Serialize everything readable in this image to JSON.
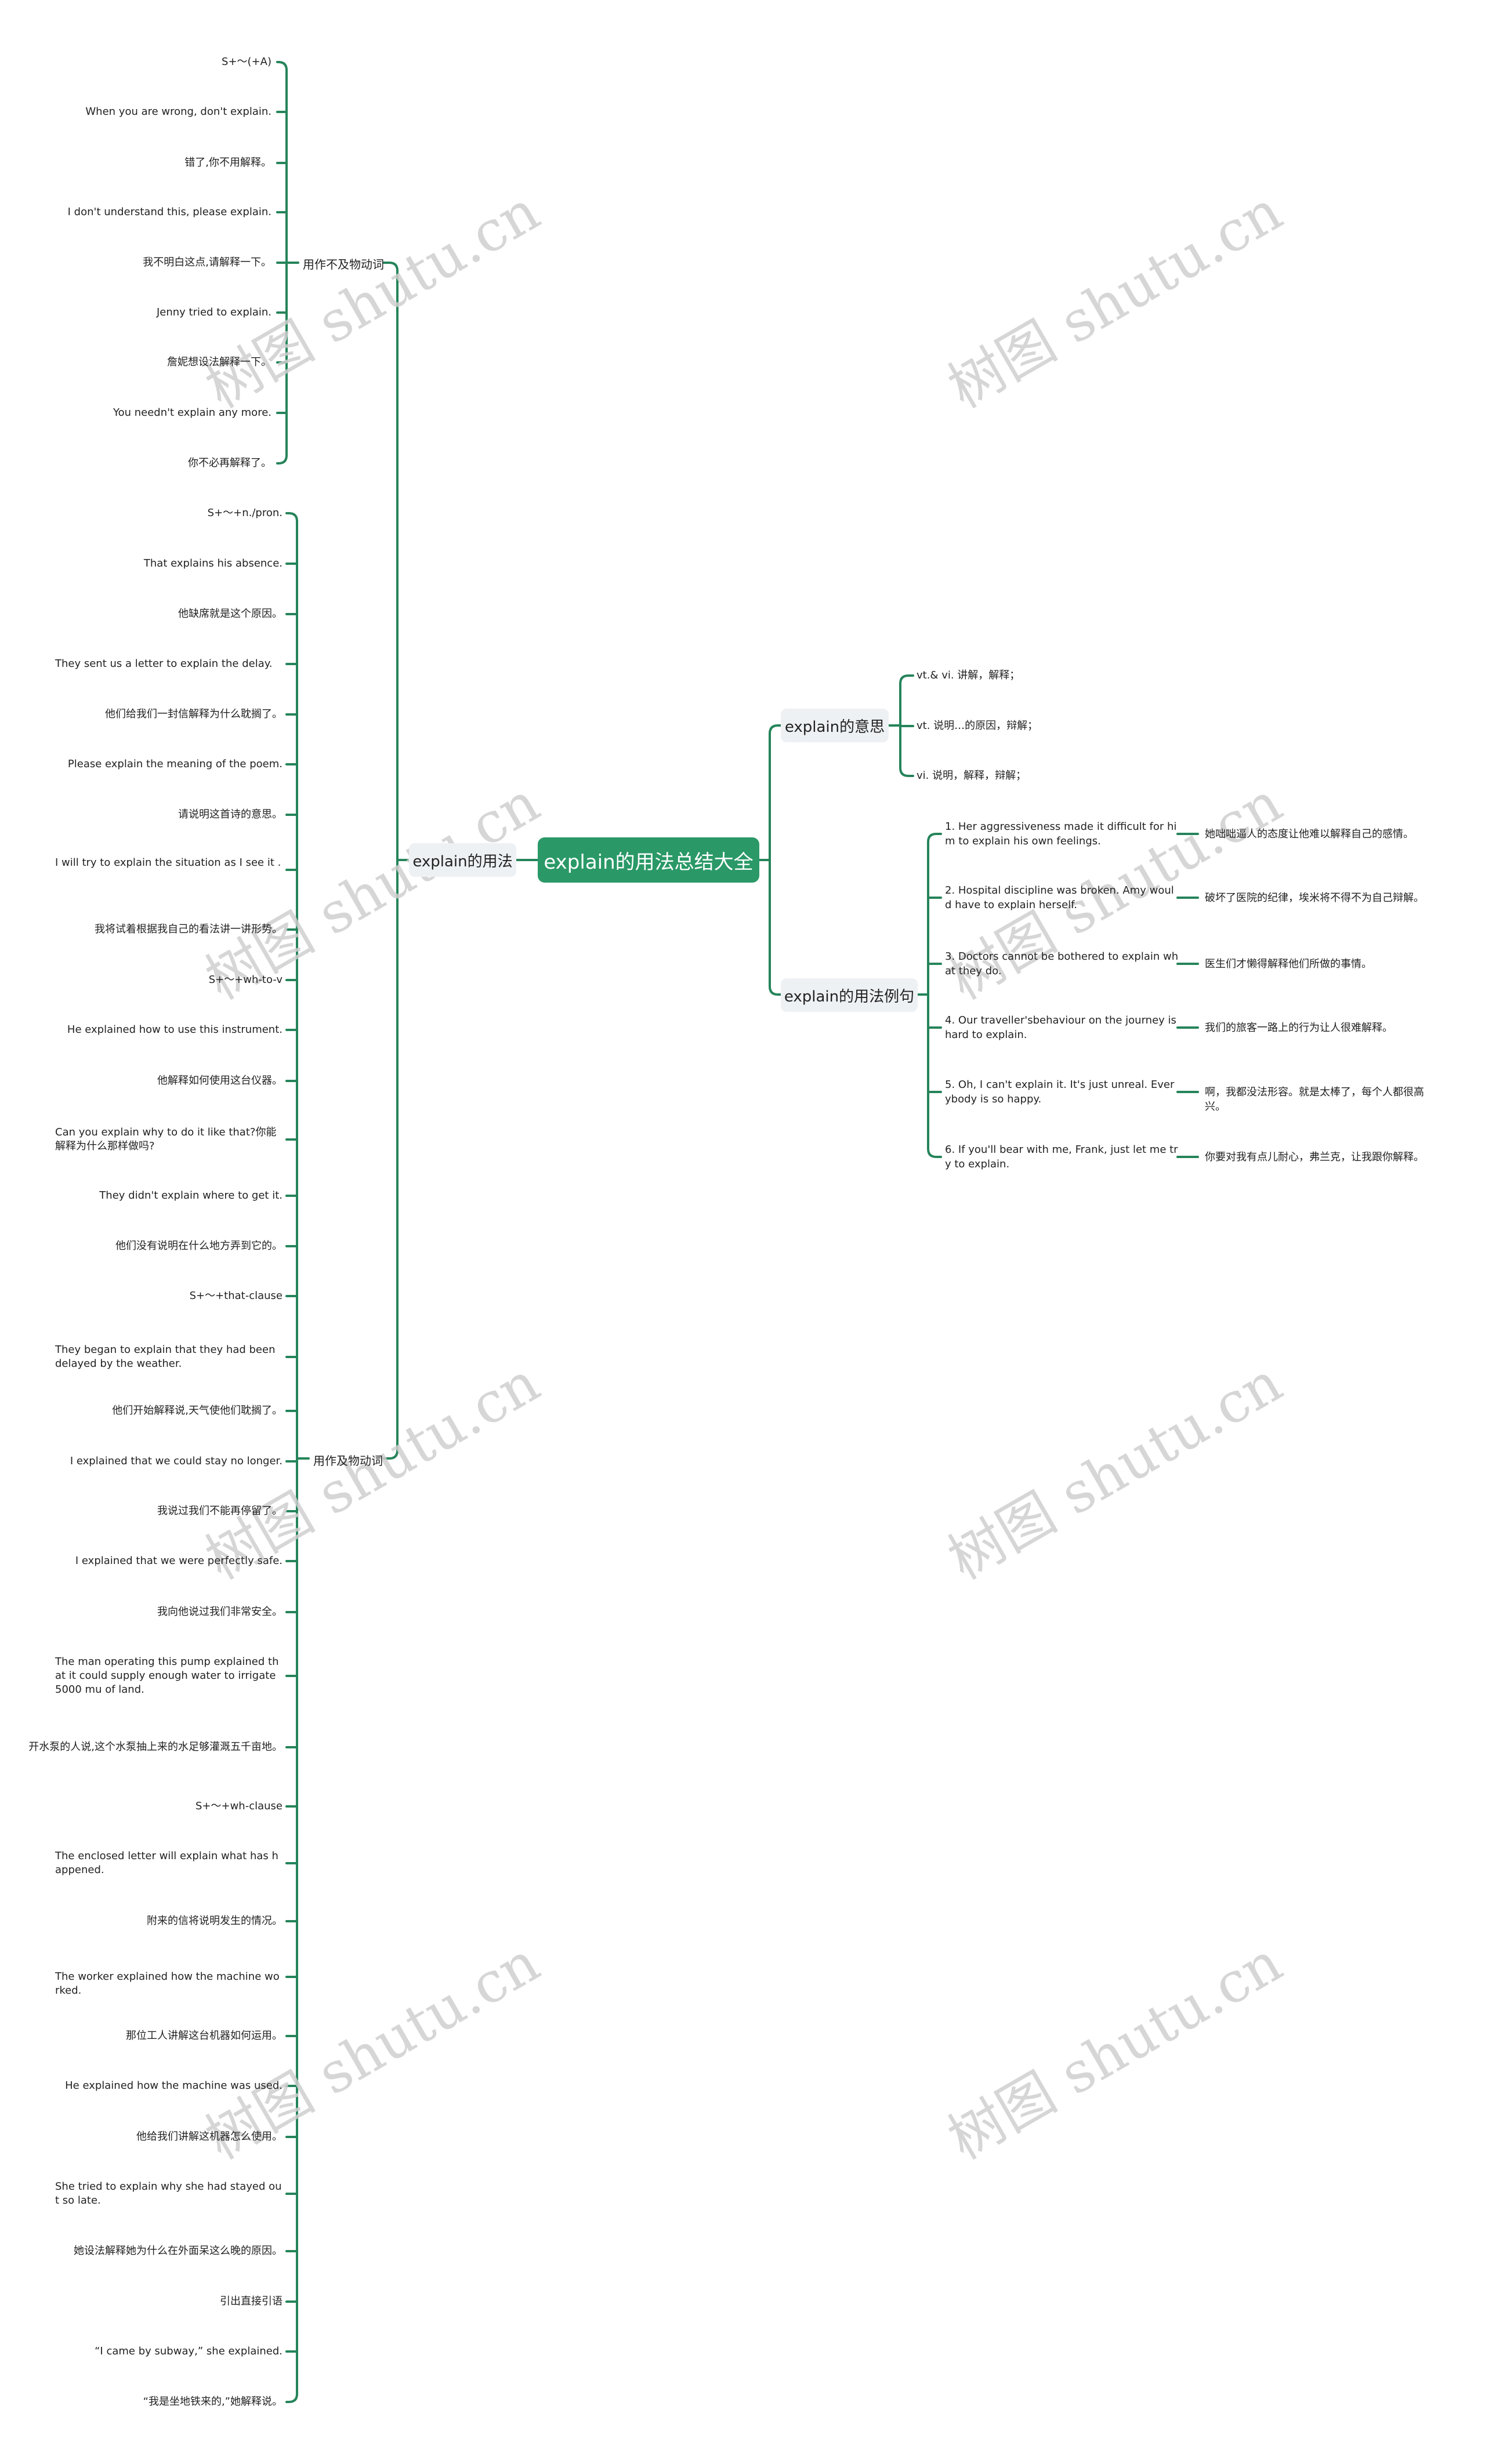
{
  "title": "explain的用法总结大全",
  "colors": {
    "line": "#25845a",
    "root_bg": "#2a9967",
    "sub_bg": "#eef1f4",
    "watermark": "#cfcfcf"
  },
  "watermark": "树图 shutu.cn",
  "left": {
    "label": "explain的用法",
    "intransitive": {
      "label": "用作不及物动词",
      "items": [
        "S+～(+A)",
        "When you are wrong, don't explain.",
        "错了,你不用解释。",
        "I don't understand this, please explain.",
        "我不明白这点,请解释一下。",
        "Jenny tried to explain.",
        "詹妮想设法解释一下。",
        "You needn't explain any more.",
        "你不必再解释了。"
      ]
    },
    "transitive": {
      "label": "用作及物动词",
      "items": [
        "S+～+n./pron.",
        "That explains his absence.",
        "他缺席就是这个原因。",
        "They sent us a letter to explain the delay.",
        "他们给我们一封信解释为什么耽搁了。",
        "Please explain the meaning of the poem.",
        "请说明这首诗的意思。",
        "I will try to explain the situation as I see it .",
        "我将试着根据我自己的看法讲一讲形势。",
        "S+～+wh-to-v",
        "He explained how to use this instrument.",
        "他解释如何使用这台仪器。",
        "Can you explain why to do it like that?你能解释为什么那样做吗?",
        "They didn't explain where to get it.",
        "他们没有说明在什么地方弄到它的。",
        "S+～+that-clause",
        "They began to explain that they had been delayed by the weather.",
        "他们开始解释说,天气使他们耽搁了。",
        "I explained that we could stay no longer.",
        "我说过我们不能再停留了。",
        "I explained that we were perfectly safe.",
        "我向他说过我们非常安全。",
        "The man operating this pump explained that it could supply enough water to irrigate 5000 mu of land.",
        "开水泵的人说,这个水泵抽上来的水足够灌溉五千亩地。",
        "S+～+wh-clause",
        "The enclosed letter will explain what has happened.",
        "附来的信将说明发生的情况。",
        "The worker explained how the machine worked.",
        "那位工人讲解这台机器如何运用。",
        "He explained how the machine was used.",
        "他给我们讲解这机器怎么使用。",
        "She tried to explain why she had stayed out so late.",
        "她设法解释她为什么在外面呆这么晚的原因。",
        "引出直接引语",
        "“I came by subway,”  she explained.",
        "“我是坐地铁来的,”她解释说。"
      ]
    }
  },
  "right": {
    "meaning": {
      "label": "explain的意思",
      "items": [
        "vt.& vi. 讲解，解释；",
        "vt. 说明…的原因，辩解；",
        "vi. 说明，解释，辩解；"
      ]
    },
    "examples": {
      "label": "explain的用法例句",
      "items": [
        {
          "en": "1. Her aggressiveness made it difficult for him to explain his own feelings.",
          "zh": "她咄咄逼人的态度让他难以解释自己的感情。"
        },
        {
          "en": "2. Hospital discipline was broken. Amy would have to explain herself.",
          "zh": "破坏了医院的纪律，埃米将不得不为自己辩解。"
        },
        {
          "en": "3. Doctors cannot be bothered to explain what they do.",
          "zh": "医生们才懒得解释他们所做的事情。"
        },
        {
          "en": "4. Our traveller'sbehaviour on the journey is hard to explain.",
          "zh": "我们的旅客一路上的行为让人很难解释。"
        },
        {
          "en": "5. Oh, I can't explain it. It's just unreal. Everybody is so happy.",
          "zh": "啊，我都没法形容。就是太棒了，每个人都很高兴。"
        },
        {
          "en": "6. If you'll bear with me, Frank, just let me try to explain.",
          "zh": "你要对我有点儿耐心，弗兰克，让我跟你解释。"
        }
      ]
    }
  }
}
